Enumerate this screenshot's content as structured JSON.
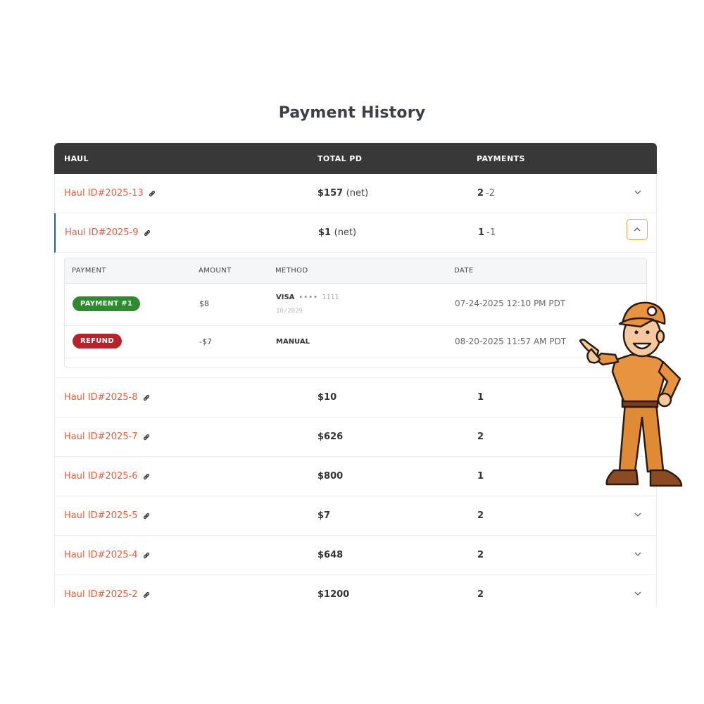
{
  "title": "Payment History",
  "columns": {
    "haul": "HAUL",
    "total": "TOTAL PD",
    "payments": "PAYMENTS"
  },
  "rows": [
    {
      "haul": "Haul ID#2025-13",
      "total": "$157",
      "total_note": "(net)",
      "payments": "2",
      "payments_delta": "-2",
      "expanded": false
    },
    {
      "haul": "Haul ID#2025-9",
      "total": "$1",
      "total_note": "(net)",
      "payments": "1",
      "payments_delta": "-1",
      "expanded": true
    },
    {
      "haul": "Haul ID#2025-8",
      "total": "$10",
      "payments": "1"
    },
    {
      "haul": "Haul ID#2025-7",
      "total": "$626",
      "payments": "2"
    },
    {
      "haul": "Haul ID#2025-6",
      "total": "$800",
      "payments": "1"
    },
    {
      "haul": "Haul ID#2025-5",
      "total": "$7",
      "payments": "2"
    },
    {
      "haul": "Haul ID#2025-4",
      "total": "$648",
      "payments": "2"
    },
    {
      "haul": "Haul ID#2025-2",
      "total": "$1200",
      "payments": "2"
    }
  ],
  "detail": {
    "columns": {
      "payment": "PAYMENT",
      "amount": "AMOUNT",
      "method": "METHOD",
      "date": "DATE"
    },
    "items": [
      {
        "badge": "PAYMENT #1",
        "badge_color": "#2d8a2d",
        "amount": "$8",
        "method": "VISA",
        "card_dots": "••••",
        "card_last4": "1111",
        "card_exp": "10/2029",
        "date": "07-24-2025 12:10 PM PDT"
      },
      {
        "badge": "REFUND",
        "badge_color": "#b5242a",
        "amount": "-$7",
        "method": "MANUAL",
        "date": "08-20-2025 11:57 AM PDT"
      }
    ]
  },
  "colors": {
    "header_bg": "#383838",
    "link": "#ef5a3a",
    "active_border": "#1f5fae",
    "expand_button_border": "#f0a04b"
  },
  "icons": {
    "link": "link-icon",
    "expand": "chevron-down-icon",
    "collapse": "chevron-up-icon"
  }
}
